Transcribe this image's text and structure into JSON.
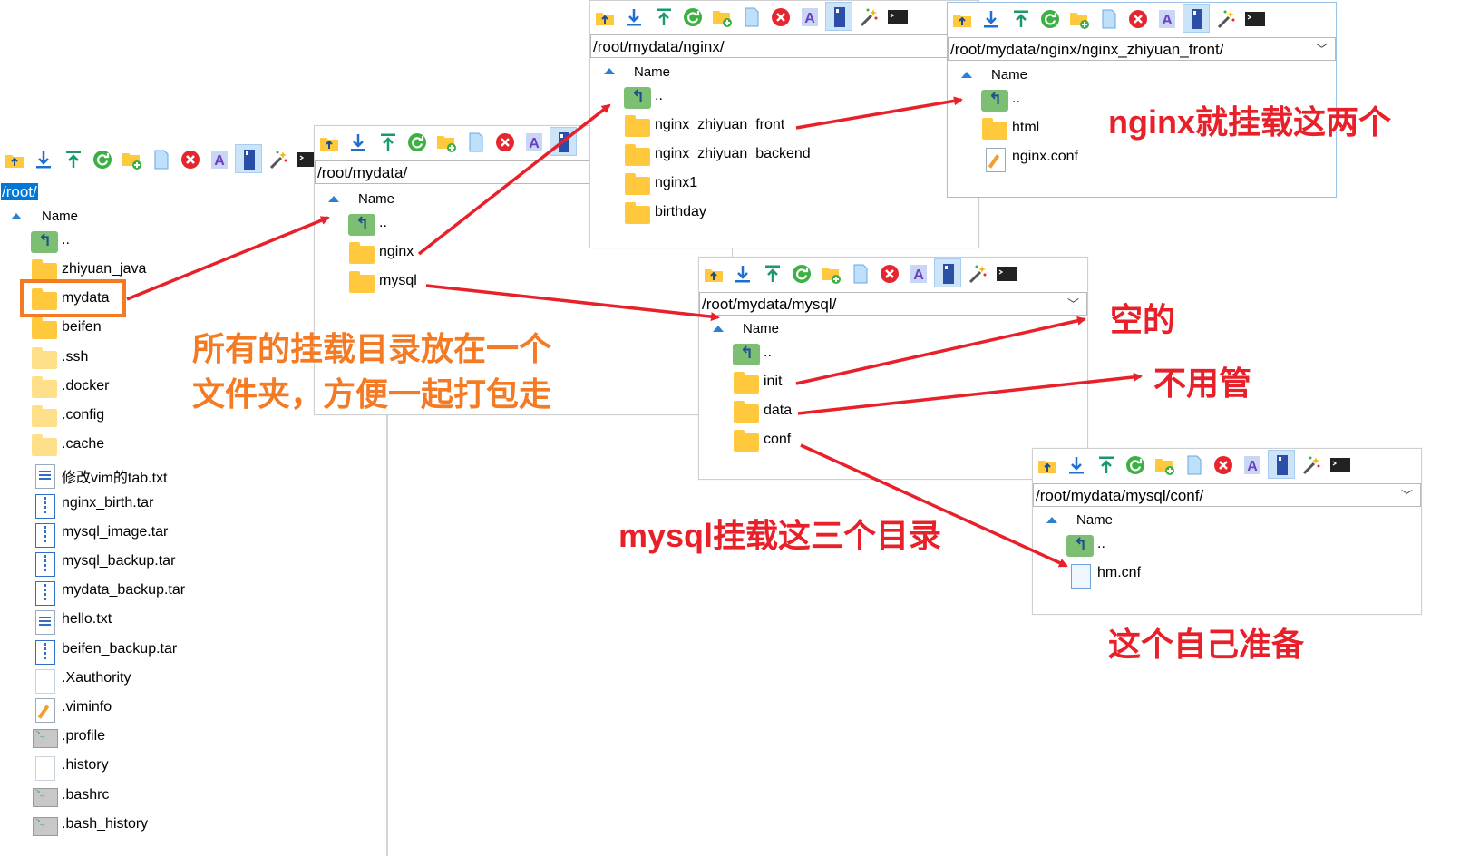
{
  "colors": {
    "annotation_red": "#e8202a",
    "annotation_orange": "#f47a24",
    "selection_blue": "#0078d7"
  },
  "toolbar_icons": [
    "parent-folder-icon",
    "download-icon",
    "upload-icon",
    "refresh-icon",
    "new-folder-icon",
    "new-file-icon",
    "delete-icon",
    "rename-icon",
    "properties-icon",
    "magic-wand-icon",
    "terminal-icon"
  ],
  "column_header": "Name",
  "up_label": "..",
  "panels": {
    "root": {
      "path": "/root/",
      "items": [
        {
          "name": "zhiyuan_java",
          "type": "folder"
        },
        {
          "name": "mydata",
          "type": "folder"
        },
        {
          "name": "beifen",
          "type": "folder"
        },
        {
          "name": ".ssh",
          "type": "folder-light"
        },
        {
          "name": ".docker",
          "type": "folder-light"
        },
        {
          "name": ".config",
          "type": "folder-light"
        },
        {
          "name": ".cache",
          "type": "folder-light"
        },
        {
          "name": "修改vim的tab.txt",
          "type": "txt"
        },
        {
          "name": "nginx_birth.tar",
          "type": "tar"
        },
        {
          "name": "mysql_image.tar",
          "type": "tar"
        },
        {
          "name": "mysql_backup.tar",
          "type": "tar"
        },
        {
          "name": "mydata_backup.tar",
          "type": "tar"
        },
        {
          "name": "hello.txt",
          "type": "txt"
        },
        {
          "name": "beifen_backup.tar",
          "type": "tar"
        },
        {
          "name": ".Xauthority",
          "type": "blank"
        },
        {
          "name": ".viminfo",
          "type": "conf"
        },
        {
          "name": ".profile",
          "type": "term"
        },
        {
          "name": ".history",
          "type": "blank"
        },
        {
          "name": ".bashrc",
          "type": "term"
        },
        {
          "name": ".bash_history",
          "type": "term"
        }
      ]
    },
    "mydata": {
      "path": "/root/mydata/",
      "items": [
        {
          "name": "nginx",
          "type": "folder"
        },
        {
          "name": "mysql",
          "type": "folder"
        }
      ]
    },
    "nginx": {
      "path": "/root/mydata/nginx/",
      "items": [
        {
          "name": "nginx_zhiyuan_front",
          "type": "folder"
        },
        {
          "name": "nginx_zhiyuan_backend",
          "type": "folder"
        },
        {
          "name": "nginx1",
          "type": "folder"
        },
        {
          "name": "birthday",
          "type": "folder"
        }
      ]
    },
    "nginx_front": {
      "path": "/root/mydata/nginx/nginx_zhiyuan_front/",
      "items": [
        {
          "name": "html",
          "type": "folder"
        },
        {
          "name": "nginx.conf",
          "type": "conf"
        }
      ]
    },
    "mysql": {
      "path": "/root/mydata/mysql/",
      "items": [
        {
          "name": "init",
          "type": "folder"
        },
        {
          "name": "data",
          "type": "folder"
        },
        {
          "name": "conf",
          "type": "folder"
        }
      ]
    },
    "mysql_conf": {
      "path": "/root/mydata/mysql/conf/",
      "items": [
        {
          "name": "hm.cnf",
          "type": "cnf"
        }
      ]
    }
  },
  "annotations": {
    "all_mounts_line1": "所有的挂载目录放在一个",
    "all_mounts_line2": "文件夹，方便一起打包走",
    "nginx_mounts": "nginx就挂载这两个",
    "empty": "空的",
    "ignore": "不用管",
    "mysql_mounts": "mysql挂载这三个目录",
    "prepare_yourself": "这个自己准备"
  }
}
